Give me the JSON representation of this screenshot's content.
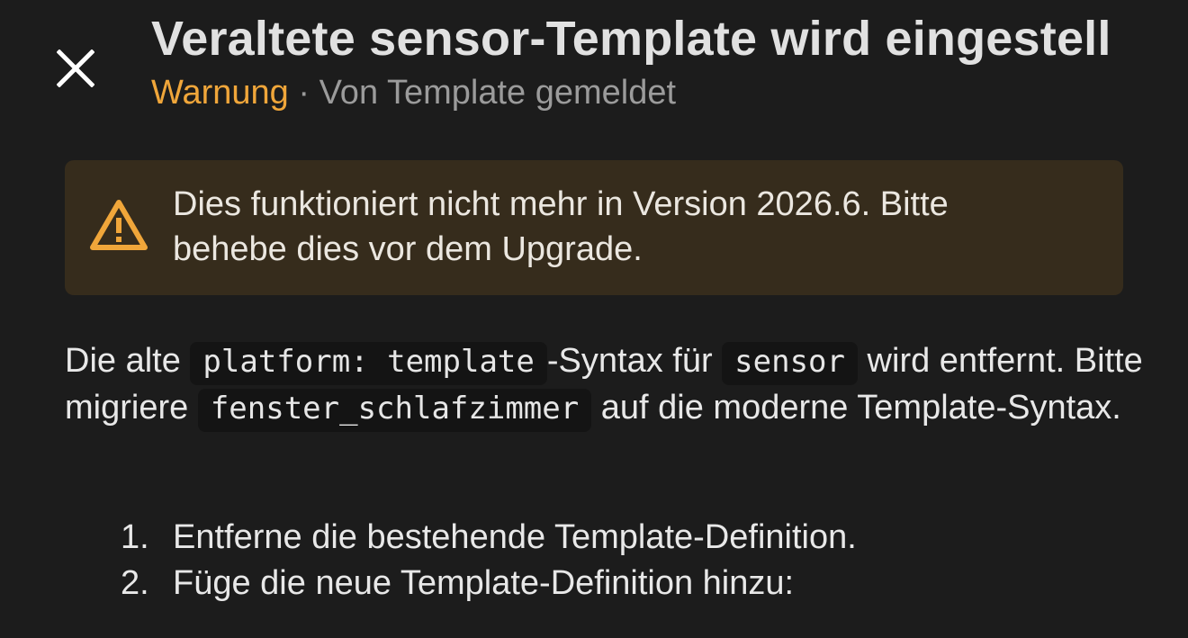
{
  "dialog": {
    "title": "Veraltete sensor-Template wird eingestell",
    "severity": "Warnung",
    "separator": " · ",
    "reporter": "Von Template gemeldet",
    "close_icon": "close-icon"
  },
  "alert": {
    "icon": "warning-icon",
    "color": "#f0a63a",
    "text": "Dies funktioniert nicht mehr in Version 2026.6. Bitte behebe dies vor dem Upgrade."
  },
  "description": {
    "part1": "Die alte ",
    "code1": "platform: template",
    "part2": "-Syntax für ",
    "code2": "sensor",
    "part3": " wird entfernt. Bitte migriere ",
    "code3": "fenster_schlafzimmer",
    "part4": " auf die moderne Template-Syntax."
  },
  "steps": [
    {
      "number": "1.",
      "text": "Entferne die bestehende Template-Definition."
    },
    {
      "number": "2.",
      "text": "Füge die neue Template-Definition hinzu:"
    }
  ]
}
